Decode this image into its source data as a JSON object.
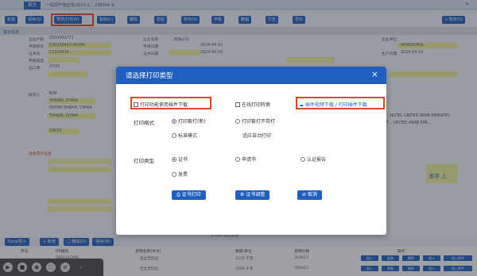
{
  "app": {
    "tab_label": "首页",
    "tab_title": "一般原产地证书(2023-0... 230004 ⊗",
    "section_title": "基本信息"
  },
  "toolbar": {
    "buttons": [
      "新建",
      "保存(S)",
      "预览/打印(P)",
      "复制(C)",
      "删除",
      "校验",
      "附件(A)",
      "申报",
      "撤销",
      "历史",
      "导出"
    ],
    "right_button": "+ 暂存(S)"
  },
  "form": {
    "rows": [
      {
        "label": "企业代码",
        "value": "0500000772",
        "label2": "企业名称",
        "value2": "...有限公司",
        "label3": "企业单位",
        "value3": "SHANDONG..."
      },
      {
        "label": "申请单号",
        "value": "C20230410-00004",
        "label2": "申请日期",
        "value2": "2024-04-10",
        "label3": "生产日期",
        "value3": "2024-04-10"
      },
      {
        "label": "证书号",
        "value": "C2320410...",
        "label2": "证书日期",
        "value2": "2024-04-10",
        "label3": "状态",
        "value3": "...."
      },
      {
        "label": "申报类型",
        "value": "..."
      }
    ],
    "exporter_label": "出口商",
    "exporter_value": "XXXX",
    "consignee_label": "收货人",
    "consignee_value": "N/M",
    "country_value": "TAINAN, CHINA",
    "country_value2": "HOHNI TAINAN, CHINA",
    "loc_value": "TIANJIN, CHINA",
    "num_value": "24633",
    "right_values": [
      "...HOTEL UNITED ARAB EMIRATES",
      "T... UNITED ARAB EMI...",
      "暂存 上"
    ],
    "note": "注意提示信息",
    "fob_label": "(FOB) 发票金额",
    "fob_value": "USD"
  },
  "bottombar": {
    "buttons": [
      "Excel导入",
      "+ 新增",
      "□ 删除(D)",
      "保存(W)"
    ]
  },
  "table": {
    "headers": [
      "序号",
      "HS编码",
      "货物名称(中文)",
      "数量/单位",
      "货物价格",
      "操作"
    ],
    "rows": [
      {
        "no": "1",
        "hs": "5003101900",
        "name": "生丝无捻丝",
        "qty": "2123 千克",
        "price": "203A23"
      },
      {
        "no": "2",
        "hs": "5003101900",
        "name": "生丝无捻丝",
        "qty": "2304 千克",
        "price": "205A23"
      }
    ],
    "row_buttons": [
      "插入",
      "复制",
      "删除",
      "插入",
      "插入附件"
    ]
  },
  "modal": {
    "title": "请选择打印类型",
    "close": "×",
    "opt_print_browser": "打印功能使用插件下载",
    "opt_online_convert": "在线打印转换",
    "opt_download_plugin": "插件视频下载 / 打印插件下载",
    "print_format_label": "打印格式",
    "fmt_option1": "打印套打(新)",
    "fmt_option2": "打印套打不带打",
    "fmt_option3": "标准模式",
    "fmt_option4": "适应自动打印",
    "print_type_label": "打印类型",
    "type_certificate": "证书",
    "type_application": "申请书",
    "type_cert_copy": "认证报告",
    "type_invoice": "发票",
    "btn_print_cert": "证书打印",
    "btn_adjust_cert": "证书调整",
    "btn_cancel": "取消"
  },
  "colors": {
    "primary": "#1f5fbf",
    "highlight": "#e2481e",
    "field_yellow": "#f4f49a"
  },
  "icons": {
    "close": "close-icon",
    "printer": "printer-icon",
    "cloud": "cloud-download-icon",
    "gear": "gear-icon",
    "cancel": "cancel-icon"
  }
}
